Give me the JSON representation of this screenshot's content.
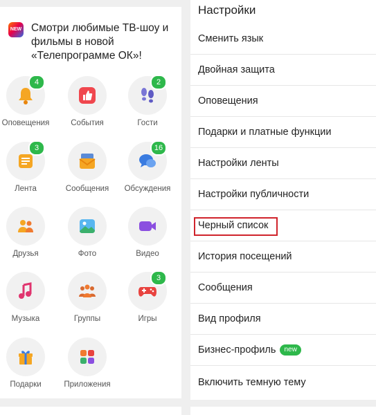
{
  "promo": {
    "logo_text": "NEW",
    "text": "Смотри любимые ТВ-шоу и фильмы в новой «Телепрограмме ОК»!"
  },
  "tiles": [
    {
      "label": "Оповещения",
      "badge": "4",
      "icon": "bell-icon"
    },
    {
      "label": "События",
      "badge": "",
      "icon": "thumbs-up-icon"
    },
    {
      "label": "Гости",
      "badge": "2",
      "icon": "footprints-icon"
    },
    {
      "label": "Лента",
      "badge": "3",
      "icon": "feed-icon"
    },
    {
      "label": "Сообщения",
      "badge": "",
      "icon": "envelope-icon"
    },
    {
      "label": "Обсуждения",
      "badge": "16",
      "icon": "chat-bubbles-icon"
    },
    {
      "label": "Друзья",
      "badge": "",
      "icon": "friends-icon"
    },
    {
      "label": "Фото",
      "badge": "",
      "icon": "photo-icon"
    },
    {
      "label": "Видео",
      "badge": "",
      "icon": "video-camera-icon"
    },
    {
      "label": "Музыка",
      "badge": "",
      "icon": "music-note-icon"
    },
    {
      "label": "Группы",
      "badge": "",
      "icon": "groups-icon"
    },
    {
      "label": "Игры",
      "badge": "3",
      "icon": "gamepad-icon"
    },
    {
      "label": "Подарки",
      "badge": "",
      "icon": "gift-icon"
    },
    {
      "label": "Приложения",
      "badge": "",
      "icon": "apps-grid-icon"
    }
  ],
  "settings": {
    "title": "Настройки",
    "items": [
      {
        "label": "Сменить язык"
      },
      {
        "label": "Двойная защита"
      },
      {
        "label": "Оповещения"
      },
      {
        "label": "Подарки и платные функции"
      },
      {
        "label": "Настройки ленты"
      },
      {
        "label": "Настройки публичности"
      },
      {
        "label": "Черный список"
      },
      {
        "label": "История посещений"
      },
      {
        "label": "Сообщения"
      },
      {
        "label": "Вид профиля"
      },
      {
        "label": "Бизнес-профиль",
        "pill": "new"
      },
      {
        "label": "Включить темную тему"
      }
    ]
  },
  "colors": {
    "badge_green": "#2eb84b",
    "highlight_red": "#d0232b",
    "accent_orange": "#ee8208"
  }
}
